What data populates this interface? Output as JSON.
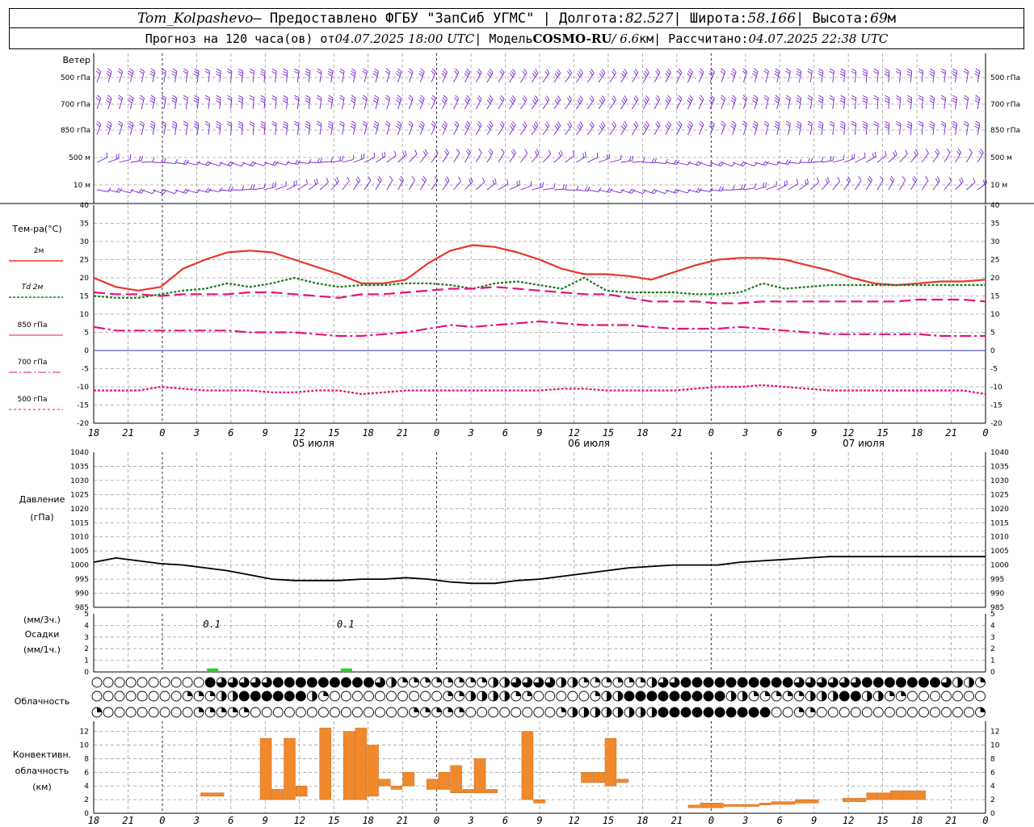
{
  "header": {
    "station": "Tom_Kolpashevo",
    "provided": " — Предоставлено ФГБУ \"ЗапСиб УГМС\" | Долгота: ",
    "lon": "82.527",
    "lat_label": " | Широта: ",
    "lat": "58.166",
    "alt_label": " | Высота: ",
    "alt": "69",
    "alt_unit": "м",
    "forecast_label": "Прогноз на 120 часа(ов) от ",
    "run_time": "04.07.2025 18:00 UTC",
    "model_label": "  | Модель ",
    "model": "COSMO-RU",
    "model_res": " / 6.6",
    "model_res_unit": "км",
    "calc_label": " | Рассчитано: ",
    "calc_time": "04.07.2025 22:38 UTC"
  },
  "colors": {
    "t2m": "#e8352c",
    "td2m": "#1a7a1a",
    "t850": "#e0147a",
    "t700": "#e0147a",
    "t500": "#e0147a",
    "zero_line": "#3030d0",
    "wind": "#7a20d0",
    "pressure": "#000000",
    "precip": "#2ec82e",
    "convective": "#f0882c",
    "grid": "#a0a0a0"
  },
  "time_axis": {
    "ticks": [
      "18",
      "21",
      "0",
      "3",
      "6",
      "9",
      "12",
      "15",
      "18",
      "21",
      "0",
      "3",
      "6",
      "9",
      "12",
      "15",
      "18",
      "21",
      "0",
      "3",
      "6",
      "9",
      "12",
      "15",
      "18",
      "21",
      "0"
    ],
    "dates": [
      "05 июля",
      "06 июля",
      "07 июля"
    ]
  },
  "wind_panel": {
    "title": "Ветер",
    "levels": [
      "500 гПа",
      "700 гПа",
      "850 гПа",
      "500 м",
      "10  м"
    ]
  },
  "temperature_panel": {
    "title": "Тем-ра(°C)",
    "legend": [
      "2м",
      "Td  2м",
      "850 гПа",
      "700 гПа",
      "500 гПа"
    ],
    "ticks": [
      "40",
      "35",
      "30",
      "25",
      "20",
      "15",
      "10",
      "5",
      "0",
      "-5",
      "-10",
      "-15",
      "-20"
    ]
  },
  "pressure_panel": {
    "title": "Давление",
    "unit": "(гПа)",
    "ticks": [
      "1040",
      "1035",
      "1030",
      "1025",
      "1020",
      "1015",
      "1010",
      "1005",
      "1000",
      "995",
      "990",
      "985"
    ]
  },
  "precip_panel": {
    "label_top": "(мм/3ч.)",
    "label_mid": "Осадки",
    "label_bot": "(мм/1ч.)",
    "ticks": [
      "5",
      "4",
      "3",
      "2",
      "1",
      "0"
    ],
    "annotations": [
      "0.1",
      "0.1"
    ]
  },
  "cloud_panel": {
    "title": "Облачность"
  },
  "convective_panel": {
    "title_1": "Конвективн.",
    "title_2": "облачность",
    "title_3": "(км)",
    "ticks": [
      "12",
      "10",
      "8",
      "6",
      "4",
      "2",
      "0"
    ]
  },
  "chart_data": [
    {
      "type": "line",
      "title": "Тем-ра(°C)",
      "x_hours": [
        0,
        3,
        6,
        9,
        12,
        15,
        18,
        21,
        24,
        27,
        30,
        33,
        36,
        39,
        42,
        45,
        48,
        51,
        54,
        57,
        60,
        63,
        66,
        69,
        72,
        75,
        78,
        81,
        84,
        87,
        90,
        93,
        96,
        99,
        102,
        105,
        108,
        111,
        114,
        117,
        120
      ],
      "ylim": [
        -20,
        40
      ],
      "series": [
        {
          "name": "2м",
          "values": [
            20,
            17.5,
            16.5,
            17.5,
            22.5,
            25,
            27,
            27.5,
            27,
            25,
            23,
            21,
            18.5,
            18.5,
            19.5,
            24,
            27.5,
            29,
            28.5,
            27,
            25,
            22.5,
            21,
            21,
            20.5,
            19.5,
            21.5,
            23.5,
            25,
            25.5,
            25.5,
            25,
            23.5,
            22,
            20,
            18.5,
            18,
            18.5,
            19,
            19,
            19.5
          ]
        },
        {
          "name": "Td  2м",
          "values": [
            15,
            14.5,
            14.5,
            15.5,
            16.5,
            17,
            18.5,
            17.5,
            18.5,
            20,
            18.5,
            17.5,
            18,
            18,
            18.5,
            18.5,
            18,
            17,
            18.5,
            19,
            18,
            17,
            20,
            16.5,
            16,
            16,
            16,
            15.5,
            15.5,
            16,
            18.5,
            17,
            17.5,
            18,
            18,
            18,
            18,
            18,
            18,
            18,
            18
          ]
        },
        {
          "name": "850 гПа",
          "values": [
            16,
            15.5,
            15.5,
            15,
            15.5,
            15.5,
            15.5,
            16,
            16,
            15.5,
            15,
            14.5,
            15.5,
            15.5,
            16,
            16.5,
            17,
            17,
            17.5,
            17,
            16.5,
            16,
            15.5,
            15.5,
            14.5,
            13.5,
            13.5,
            13.5,
            13,
            13,
            13.5,
            13.5,
            13.5,
            13.5,
            13.5,
            13.5,
            13.5,
            14,
            14,
            14,
            13.5
          ]
        },
        {
          "name": "700 гПа",
          "values": [
            6.5,
            5.5,
            5.5,
            5.5,
            5.5,
            5.5,
            5.5,
            5,
            5,
            5,
            4.5,
            4,
            4,
            4.5,
            5,
            6,
            7,
            6.5,
            7,
            7.5,
            8,
            7.5,
            7,
            7,
            7,
            6.5,
            6,
            6,
            6,
            6.5,
            6,
            5.5,
            5,
            4.5,
            4.5,
            4.5,
            4.5,
            4.5,
            4,
            4,
            4
          ]
        },
        {
          "name": "500 гПа",
          "values": [
            -11,
            -11,
            -11,
            -10,
            -10.5,
            -11,
            -11,
            -11,
            -11.5,
            -11.5,
            -11,
            -11,
            -12,
            -11.5,
            -11,
            -11,
            -11,
            -11,
            -11,
            -11,
            -11,
            -10.5,
            -10.5,
            -11,
            -11,
            -11,
            -11,
            -10.5,
            -10,
            -10,
            -9.5,
            -10,
            -10.5,
            -11,
            -11,
            -11,
            -11,
            -11,
            -11,
            -11,
            -12
          ]
        }
      ]
    },
    {
      "type": "line",
      "title": "Давление",
      "ylabel": "(гПа)",
      "x_hours": [
        0,
        3,
        6,
        9,
        12,
        15,
        18,
        21,
        24,
        27,
        30,
        33,
        36,
        39,
        42,
        45,
        48,
        51,
        54,
        57,
        60,
        63,
        66,
        69,
        72,
        75,
        78,
        81,
        84,
        87,
        90,
        93,
        96,
        99,
        102,
        105,
        108,
        111,
        114,
        117,
        120
      ],
      "ylim": [
        985,
        1040
      ],
      "series": [
        {
          "name": "Давление",
          "values": [
            1001,
            1002.5,
            1001.5,
            1000.5,
            1000,
            999,
            998,
            996.5,
            995,
            994.5,
            994.5,
            994.5,
            995,
            995,
            995.5,
            995,
            994,
            993.5,
            993.5,
            994.5,
            995,
            996,
            997,
            998,
            999,
            999.5,
            1000,
            1000,
            1000,
            1001,
            1001.5,
            1002,
            1002.5,
            1003,
            1003,
            1003,
            1003,
            1003,
            1003,
            1003,
            1003
          ]
        }
      ]
    },
    {
      "type": "bar",
      "title": "Осадки",
      "ylim": [
        0,
        5
      ],
      "bars": [
        {
          "hour": 16,
          "value": 0.1
        },
        {
          "hour": 34,
          "value": 0.1
        }
      ]
    },
    {
      "type": "bar",
      "title": "Конвективн. облачность (км)",
      "ylim": [
        0,
        13
      ],
      "bars": [
        {
          "hour": 9,
          "bottom": 2.5,
          "top": 3
        },
        {
          "hour": 10,
          "bottom": 2.5,
          "top": 3
        },
        {
          "hour": 14,
          "bottom": 2,
          "top": 11
        },
        {
          "hour": 15,
          "bottom": 2,
          "top": 3.5
        },
        {
          "hour": 16,
          "bottom": 2,
          "top": 11
        },
        {
          "hour": 17,
          "bottom": 2.5,
          "top": 4
        },
        {
          "hour": 19,
          "bottom": 2,
          "top": 12.5
        },
        {
          "hour": 21,
          "bottom": 2,
          "top": 12
        },
        {
          "hour": 22,
          "bottom": 2,
          "top": 12.5
        },
        {
          "hour": 23,
          "bottom": 2.5,
          "top": 10
        },
        {
          "hour": 24,
          "bottom": 4,
          "top": 5
        },
        {
          "hour": 25,
          "bottom": 3.5,
          "top": 4
        },
        {
          "hour": 26,
          "bottom": 4,
          "top": 6
        },
        {
          "hour": 28,
          "bottom": 3.5,
          "top": 5
        },
        {
          "hour": 29,
          "bottom": 3.5,
          "top": 6
        },
        {
          "hour": 30,
          "bottom": 3,
          "top": 7
        },
        {
          "hour": 31,
          "bottom": 3,
          "top": 3.5
        },
        {
          "hour": 32,
          "bottom": 3,
          "top": 8
        },
        {
          "hour": 33,
          "bottom": 3,
          "top": 3.5
        },
        {
          "hour": 36,
          "bottom": 2,
          "top": 12
        },
        {
          "hour": 37,
          "bottom": 1.5,
          "top": 2
        },
        {
          "hour": 41,
          "bottom": 4.5,
          "top": 6
        },
        {
          "hour": 42,
          "bottom": 4.5,
          "top": 6
        },
        {
          "hour": 43,
          "bottom": 4,
          "top": 11
        },
        {
          "hour": 44,
          "bottom": 4.5,
          "top": 5
        },
        {
          "hour": 50,
          "bottom": 0.8,
          "top": 1.2
        },
        {
          "hour": 51,
          "bottom": 0.8,
          "top": 1.5
        },
        {
          "hour": 52,
          "bottom": 0.8,
          "top": 1.5
        },
        {
          "hour": 53,
          "bottom": 1,
          "top": 1.3
        },
        {
          "hour": 54,
          "bottom": 1,
          "top": 1.3
        },
        {
          "hour": 55,
          "bottom": 1,
          "top": 1.3
        },
        {
          "hour": 56,
          "bottom": 1.2,
          "top": 1.5
        },
        {
          "hour": 57,
          "bottom": 1.3,
          "top": 1.7
        },
        {
          "hour": 58,
          "bottom": 1.3,
          "top": 1.7
        },
        {
          "hour": 59,
          "bottom": 1.5,
          "top": 2
        },
        {
          "hour": 60,
          "bottom": 1.5,
          "top": 2
        },
        {
          "hour": 63,
          "bottom": 1.7,
          "top": 2.2
        },
        {
          "hour": 64,
          "bottom": 1.7,
          "top": 2.2
        },
        {
          "hour": 65,
          "bottom": 2,
          "top": 3
        },
        {
          "hour": 66,
          "bottom": 2,
          "top": 3
        },
        {
          "hour": 67,
          "bottom": 2,
          "top": 3.3
        },
        {
          "hour": 68,
          "bottom": 2,
          "top": 3.3
        },
        {
          "hour": 69,
          "bottom": 2,
          "top": 3.3
        }
      ]
    }
  ]
}
